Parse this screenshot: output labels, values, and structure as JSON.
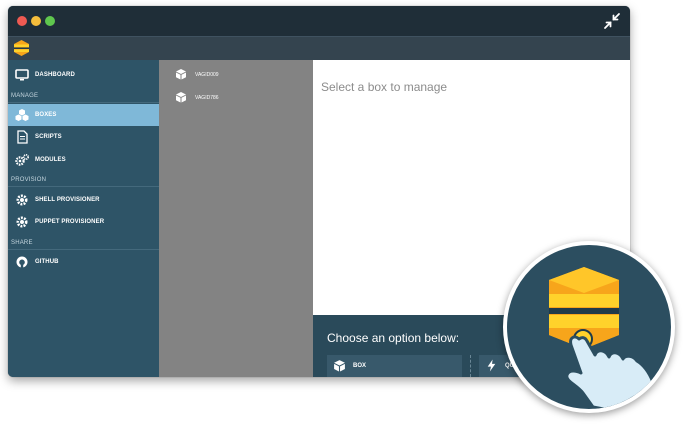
{
  "window": {
    "traffic_lights": [
      "close",
      "minimize",
      "maximize"
    ],
    "shrink_icon": "arrows-collapse-icon"
  },
  "app": {
    "logo_icon": "vagrant-layers-logo"
  },
  "sidebar": {
    "items": [
      {
        "label": "DASHBOARD",
        "icon": "monitor-icon",
        "active": false
      },
      {
        "label": "BOXES",
        "icon": "boxes-icon",
        "active": true
      },
      {
        "label": "SCRIPTS",
        "icon": "script-file-icon",
        "active": false
      },
      {
        "label": "MODULES",
        "icon": "gears-icon",
        "active": false
      },
      {
        "label": "SHELL PROVISIONER",
        "icon": "gear-icon",
        "active": false
      },
      {
        "label": "PUPPET PROVISIONER",
        "icon": "gear-icon",
        "active": false
      },
      {
        "label": "GITHUB",
        "icon": "github-icon",
        "active": false
      }
    ],
    "sections": {
      "manage": "MANAGE",
      "provision": "PROVISION",
      "share": "SHARE"
    }
  },
  "boxes": {
    "items": [
      {
        "label": "VAGID009",
        "icon": "cube-icon"
      },
      {
        "label": "VAGID786",
        "icon": "cube-icon"
      }
    ]
  },
  "main": {
    "empty_text": "Select a box to manage",
    "options_title": "Choose an option below:",
    "options": [
      {
        "label": "BOX",
        "icon": "cube-icon"
      },
      {
        "label": "QU",
        "icon": "lightning-icon"
      }
    ]
  },
  "colors": {
    "sidebar": "#2e5467",
    "active": "#7fb8d8",
    "list_panel": "#838383",
    "logo_orange": "#f7a51b",
    "logo_yellow": "#ffd22b"
  }
}
